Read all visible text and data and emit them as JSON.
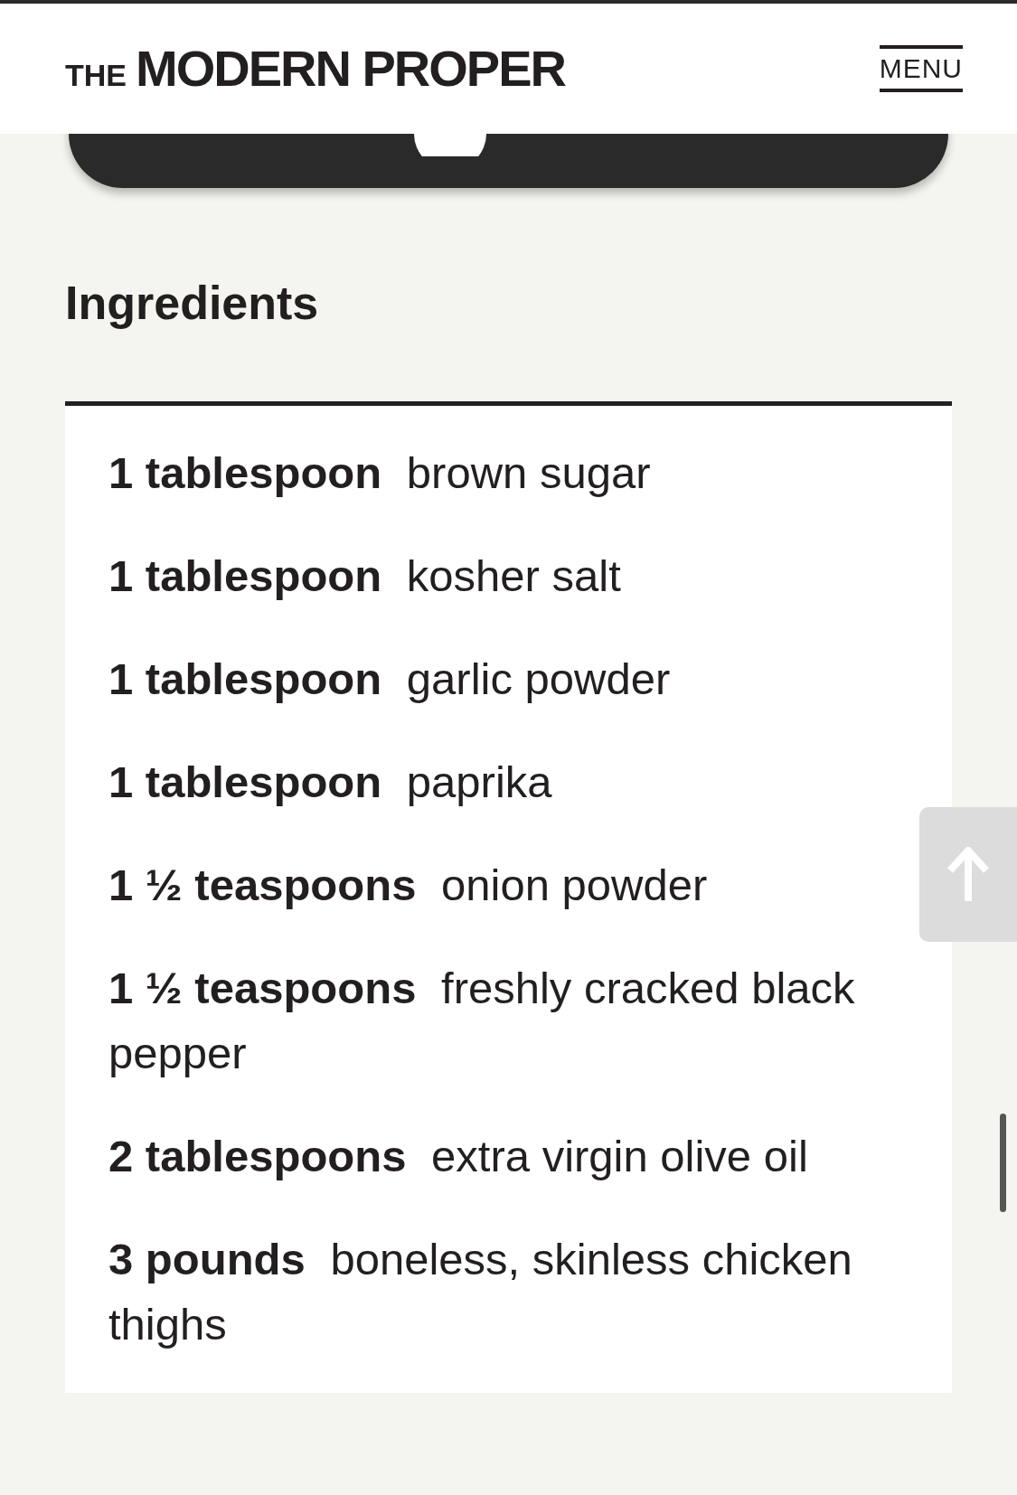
{
  "header": {
    "logo_prefix": "THE",
    "logo_main": "MODERN PROPER",
    "menu": "MENU"
  },
  "section_title": "Ingredients",
  "ingredients": [
    {
      "quantity": "1 tablespoon",
      "name": "brown sugar"
    },
    {
      "quantity": "1 tablespoon",
      "name": "kosher salt"
    },
    {
      "quantity": "1 tablespoon",
      "name": "garlic powder"
    },
    {
      "quantity": "1 tablespoon",
      "name": "paprika"
    },
    {
      "quantity": "1 ½ teaspoons",
      "name": "onion powder"
    },
    {
      "quantity": "1 ½ teaspoons",
      "name": "freshly cracked black pepper"
    },
    {
      "quantity": "2 tablespoons",
      "name": "extra virgin olive oil"
    },
    {
      "quantity": "3 pounds",
      "name": "boneless, skinless chicken thighs"
    }
  ]
}
